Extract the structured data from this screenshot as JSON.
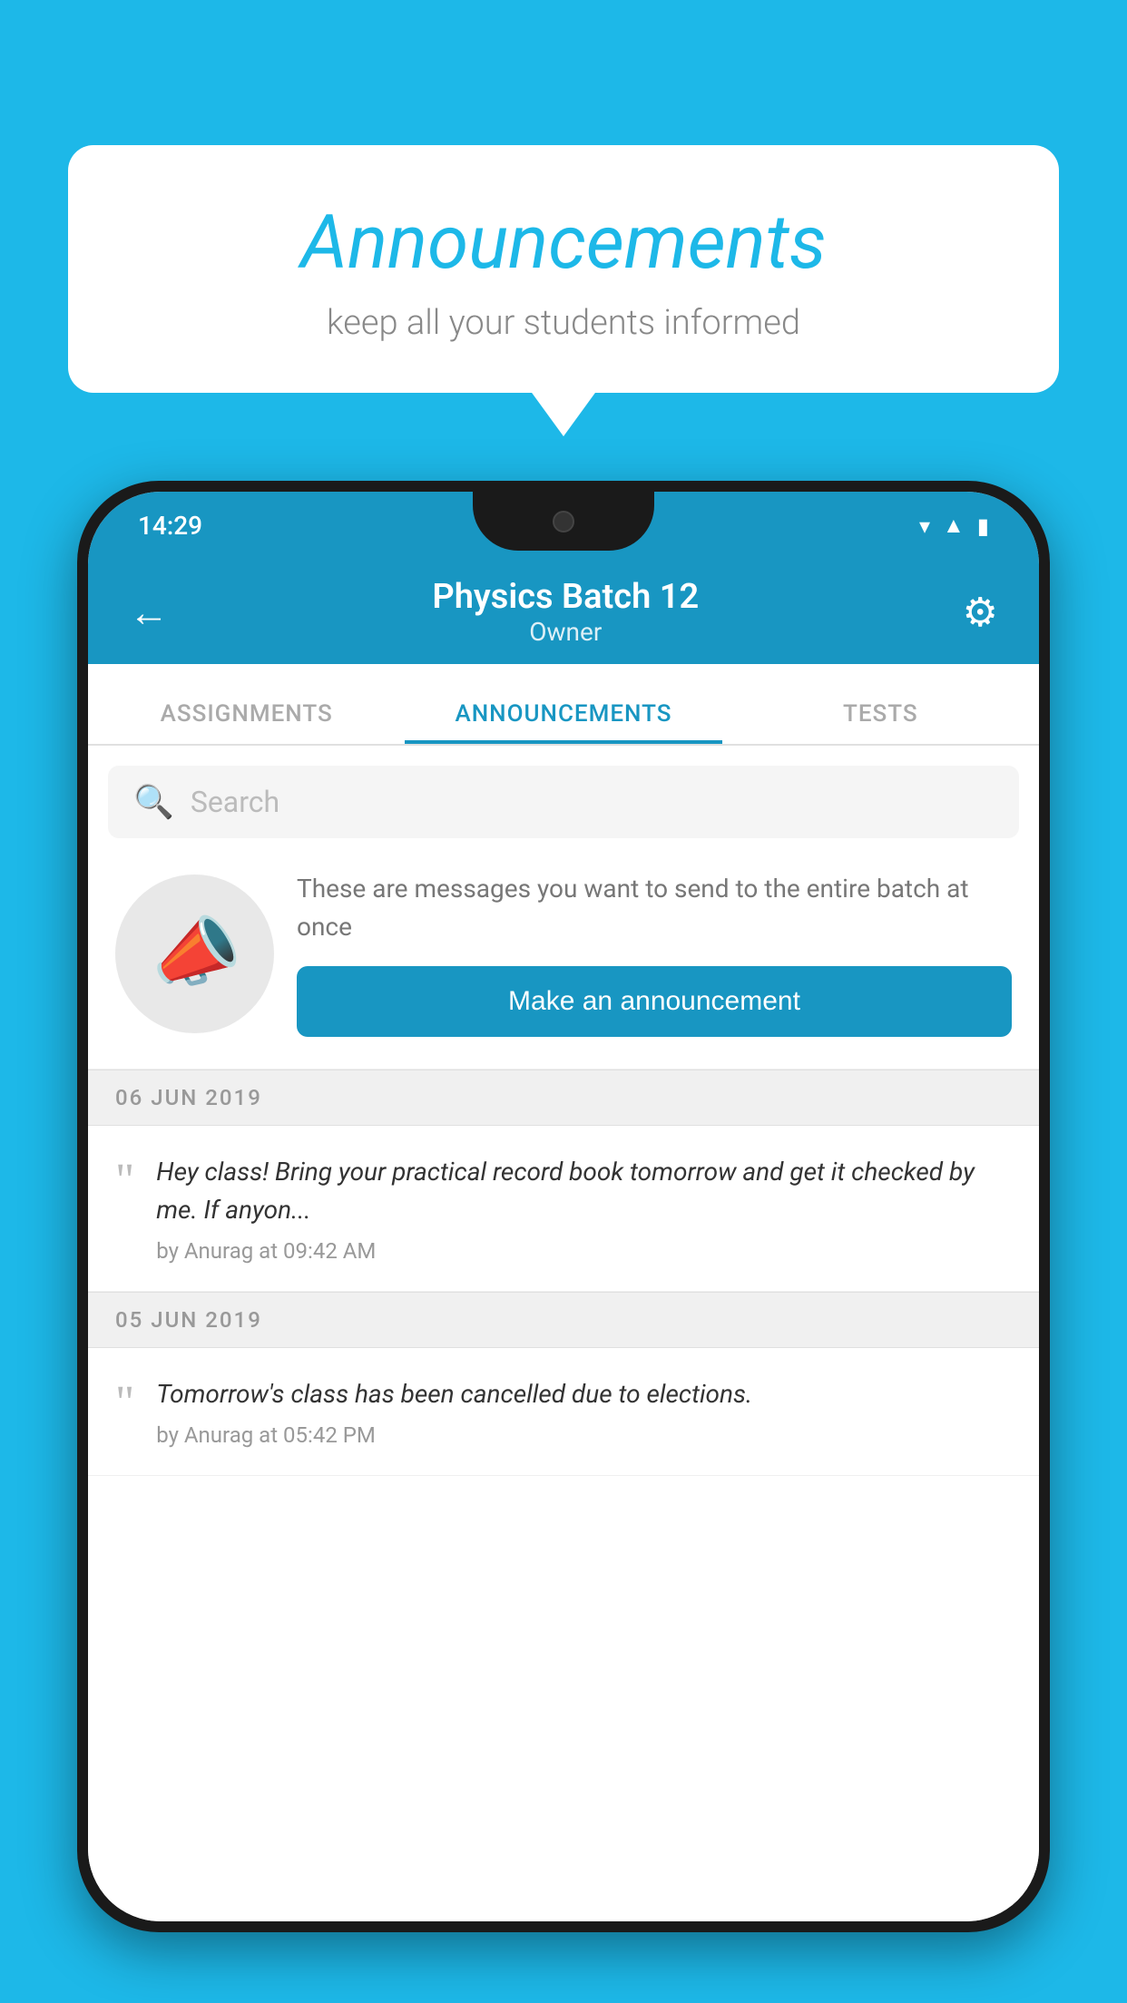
{
  "background_color": "#1DB8E8",
  "speech_bubble": {
    "title": "Announcements",
    "subtitle": "keep all your students informed"
  },
  "phone": {
    "status_bar": {
      "time": "14:29",
      "icons": [
        "wifi",
        "signal",
        "battery"
      ]
    },
    "app_bar": {
      "back_label": "←",
      "title": "Physics Batch 12",
      "subtitle": "Owner",
      "gear_label": "⚙"
    },
    "tabs": [
      {
        "label": "ASSIGNMENTS",
        "active": false
      },
      {
        "label": "ANNOUNCEMENTS",
        "active": true
      },
      {
        "label": "TESTS",
        "active": false
      }
    ],
    "search": {
      "placeholder": "Search"
    },
    "announcement_prompt": {
      "description": "These are messages you want to send to the entire batch at once",
      "button_label": "Make an announcement"
    },
    "announcements": [
      {
        "date": "06  JUN  2019",
        "message": "Hey class! Bring your practical record book tomorrow and get it checked by me. If anyon...",
        "meta": "by Anurag at 09:42 AM"
      },
      {
        "date": "05  JUN  2019",
        "message": "Tomorrow's class has been cancelled due to elections.",
        "meta": "by Anurag at 05:42 PM"
      }
    ]
  }
}
